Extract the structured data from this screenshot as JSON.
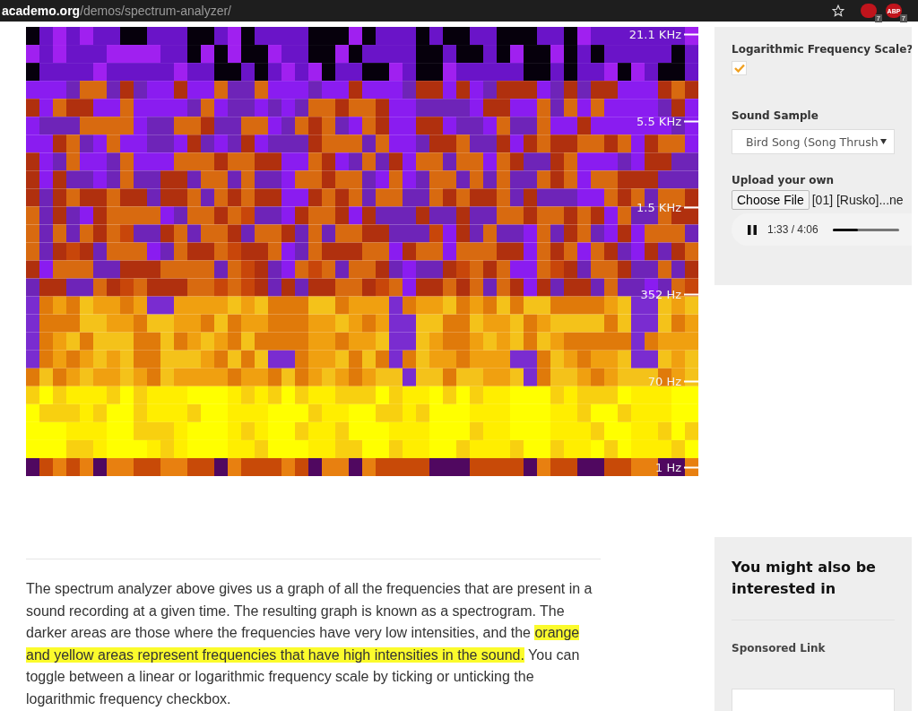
{
  "browser_bar": {
    "url_host": "academo.org",
    "url_path": "/demos/spectrum-analyzer/",
    "extensions": [
      {
        "badge": "7"
      },
      {
        "label": "ABP",
        "badge": "7"
      }
    ]
  },
  "spectrogram": {
    "axis_labels": [
      "21.1  KHz",
      "5.5  KHz",
      "1.5  KHz",
      "352  Hz",
      "70  Hz",
      "1  Hz"
    ]
  },
  "controls": {
    "log_scale": {
      "label": "Logarithmic Frequency Scale?",
      "checked": true
    },
    "sound_sample": {
      "label": "Sound Sample",
      "value": "Bird Song (Song Thrush"
    },
    "upload": {
      "label": "Upload your own",
      "button": "Choose File",
      "file_name": "[01] [Rusko]...ne"
    },
    "player": {
      "playing": true,
      "time": "1:33 / 4:06",
      "level": 0.38
    }
  },
  "article": {
    "parts": [
      {
        "text": "The spectrum analyzer above gives us a graph of all the frequencies that are present in a sound recording at a given time. The resulting graph is known as a spectrogram. The darker areas are those where the frequencies have very low intensities, and the ",
        "highlighted": false
      },
      {
        "text": "orange and yellow areas represent frequencies that have high intensities in the sound.",
        "highlighted": true
      },
      {
        "text": " You can toggle between a linear or logarithmic frequency scale by ticking or unticking the logarithmic frequency checkbox.",
        "highlighted": false
      }
    ]
  },
  "related": {
    "title": "You might also be interested in",
    "sponsored": "Sponsored Link"
  }
}
